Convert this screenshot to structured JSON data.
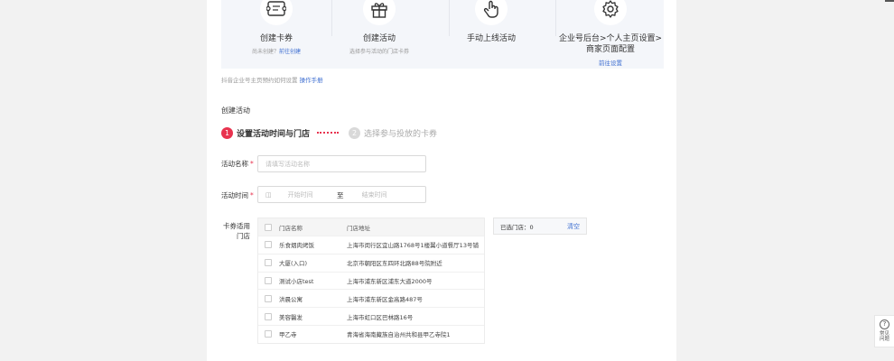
{
  "steps": [
    {
      "icon": "coupon-icon",
      "title": "创建卡券",
      "sub_prefix": "尚未创建？",
      "sub_link": "前往创建"
    },
    {
      "icon": "gift-icon",
      "title": "创建活动",
      "sub": "选择参与活动的门店卡券"
    },
    {
      "icon": "hand-pointer-icon",
      "title": "手动上线活动"
    },
    {
      "icon": "gear-icon",
      "title": "企业号后台>个人主页设置>商家页面配置",
      "link": "前往设置"
    }
  ],
  "hint": {
    "text": "抖音企业号主页预约如何设置",
    "link": "操作手册"
  },
  "section_title": "创建活动",
  "stepper": [
    {
      "num": "1",
      "label": "设置活动时间与门店"
    },
    {
      "num": "2",
      "label": "选择参与投放的卡券"
    }
  ],
  "form": {
    "name_label": "活动名称",
    "name_placeholder": "请填写活动名称",
    "time_label": "活动时间",
    "time_icon_text": "◫",
    "start_placeholder": "开始时间",
    "time_sep": "至",
    "end_placeholder": "结束时间",
    "store_label_line1": "卡券适用",
    "store_label_line2": "门店",
    "required_mark": "*"
  },
  "table": {
    "headers": [
      "门店名称",
      "门店地址"
    ],
    "rows": [
      {
        "name": "乐食烟肉烤饭",
        "address": "上海市闵行区宜山路1768号1楼翼小道餐厅13号铺"
      },
      {
        "name": "大厦(入口)",
        "address": "北京市朝阳区东四环北路88号院附近"
      },
      {
        "name": "测试小店test",
        "address": "上海市浦东新区浦东大道2000号"
      },
      {
        "name": "洪晨公寓",
        "address": "上海市浦东新区金高路487号"
      },
      {
        "name": "美容醫发",
        "address": "上海市虹口区巴林路16号"
      },
      {
        "name": "甲乙寺",
        "address": "青海省海南藏族自治州共和县甲乙寺院1"
      }
    ]
  },
  "selected": {
    "label": "已选门店：0",
    "clear": "清空"
  },
  "help": {
    "icon_text": "?",
    "label": "常见问题"
  },
  "colors": {
    "accent": "#e8334f",
    "link": "#3f6fd1"
  }
}
